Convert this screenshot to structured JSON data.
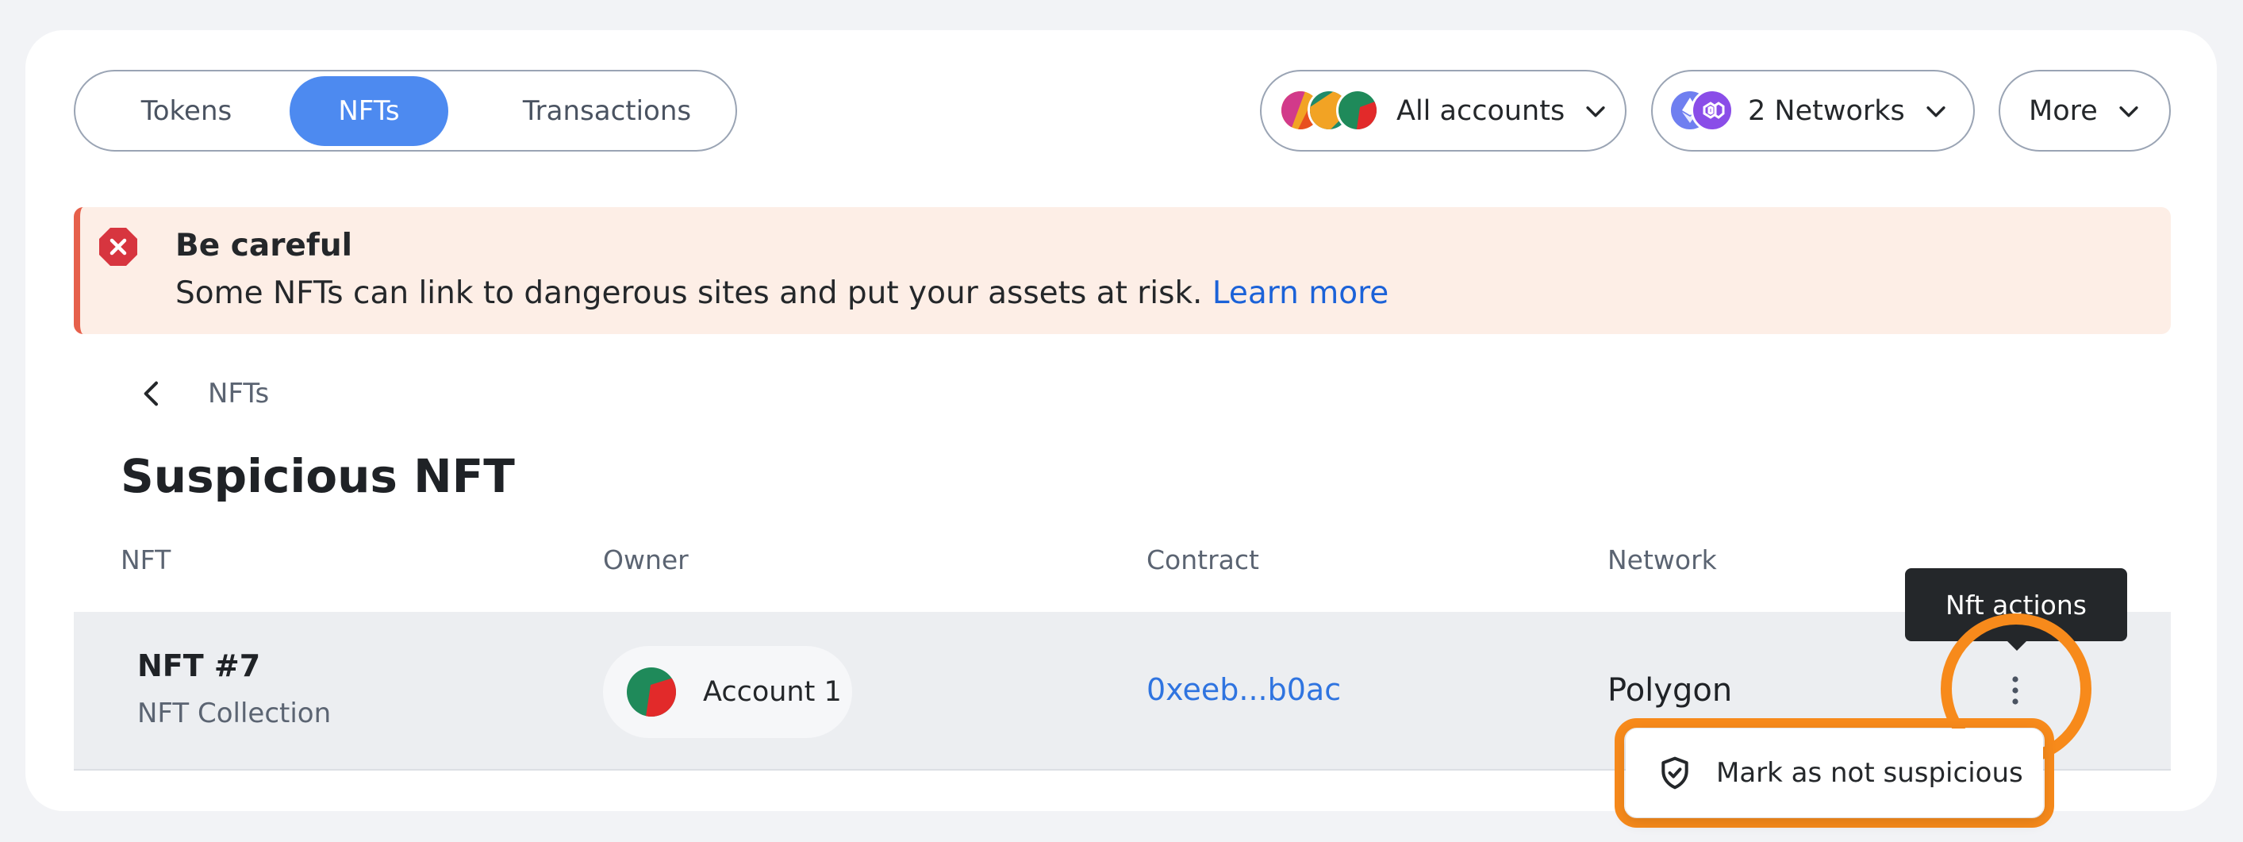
{
  "tabs": {
    "tokens": "Tokens",
    "nfts": "NFTs",
    "transactions": "Transactions",
    "active": "NFTs"
  },
  "filters": {
    "accounts_label": "All accounts",
    "networks_label": "2 Networks",
    "more_label": "More"
  },
  "banner": {
    "title": "Be careful",
    "text": "Some NFTs can link to dangerous sites and put your assets at risk.",
    "link": "Learn more"
  },
  "breadcrumb": {
    "label": "NFTs"
  },
  "page": {
    "title": "Suspicious NFT"
  },
  "table": {
    "headers": [
      "NFT",
      "Owner",
      "Contract",
      "Network"
    ],
    "rows": [
      {
        "name": "NFT #7",
        "collection": "NFT Collection",
        "owner": "Account 1",
        "contract": "0xeeb...b0ac",
        "network": "Polygon"
      }
    ]
  },
  "tooltip": {
    "text": "Nft actions"
  },
  "menu": {
    "items": [
      {
        "label": "Mark as not suspicious",
        "icon": "shield-check-icon"
      }
    ]
  },
  "colors": {
    "accent": "#4d8af0",
    "link": "#1b62d8",
    "highlight": "#f78a1b",
    "danger": "#d7353f",
    "banner_bg": "#fdeee6"
  }
}
